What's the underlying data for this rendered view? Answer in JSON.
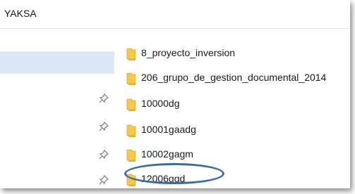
{
  "window": {
    "title": "YAKSA"
  },
  "nav": {
    "pinned_icon": "pin-icon"
  },
  "files": [
    {
      "name": "8_proyecto_inversion",
      "icon": "folder-icon"
    },
    {
      "name": "206_grupo_de_gestion_documental_2014",
      "icon": "folder-icon"
    },
    {
      "name": "10000dg",
      "icon": "folder-icon"
    },
    {
      "name": "10001gaadg",
      "icon": "folder-icon"
    },
    {
      "name": "10002gagm",
      "icon": "folder-icon"
    },
    {
      "name": "12006ggd",
      "icon": "folder-icon",
      "highlighted": true
    }
  ],
  "colors": {
    "selection": "#dbe8f6",
    "folder": "#f3c84b",
    "highlight_ring": "#3b6ba5"
  }
}
